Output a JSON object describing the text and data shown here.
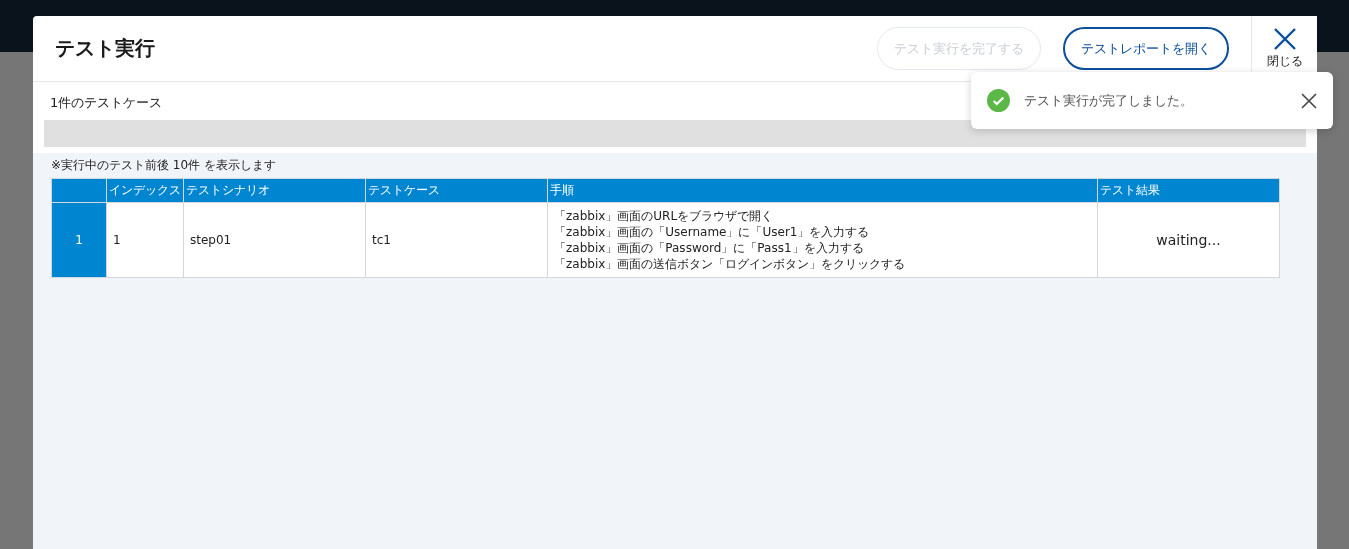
{
  "dialog": {
    "title": "テスト実行",
    "buttons": [
      {
        "label": "テスト実行を完了する",
        "disabled": true
      },
      {
        "label": "テストレポートを開く",
        "disabled": false
      }
    ],
    "close_label": "閉じる"
  },
  "case_count": "1件のテストケース",
  "progress": {
    "level": 0
  },
  "note": "※実行中のテスト前後 10件 を表示します",
  "table": {
    "columns": [
      "",
      "インデックス",
      "テストシナリオ",
      "テストケース",
      "手順",
      "テスト結果"
    ],
    "rows": [
      {
        "number": "1",
        "index": "1",
        "scenario": "step01",
        "case": "tc1",
        "steps": [
          "「zabbix」画面のURLをブラウザで開く",
          "「zabbix」画面の「Username」に「User1」を入力する",
          "「zabbix」画面の「Password」に「Pass1」を入力する",
          "「zabbix」画面の送信ボタン「ログインボタン」をクリックする"
        ],
        "result": "waiting..."
      }
    ]
  },
  "toast": {
    "kind": "success",
    "message": "テスト実行が完了しました。"
  }
}
